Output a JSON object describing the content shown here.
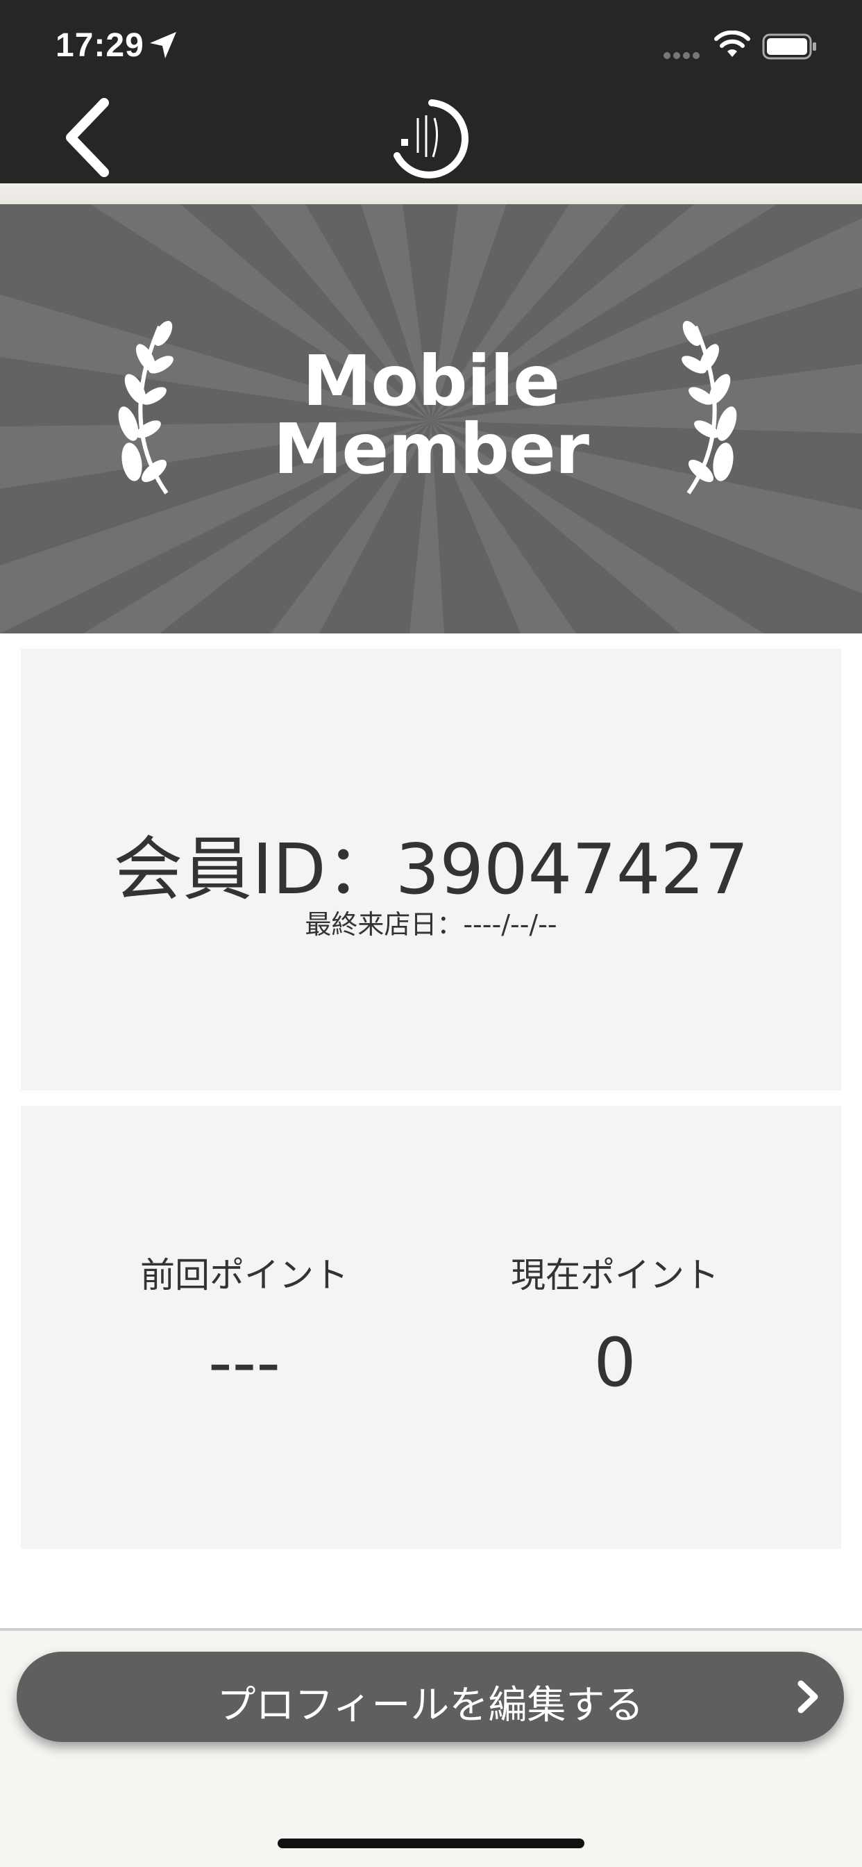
{
  "status_bar": {
    "time": "17:29"
  },
  "nav": {
    "back_icon": "chevron-left-icon",
    "logo_icon": "brand-logo-icon"
  },
  "banner": {
    "line1": "Mobile",
    "line2": "Member"
  },
  "member": {
    "id_text": "会員ID：39047427",
    "last_visit": "最終来店日：----/--/--"
  },
  "points": {
    "previous_label": "前回ポイント",
    "previous_value": "---",
    "current_label": "現在ポイント",
    "current_value": "0"
  },
  "actions": {
    "edit_profile_label": "プロフィールを編集する"
  },
  "colors": {
    "topbar": "#262626",
    "banner": "#636363",
    "card": "#f4f4f4",
    "button": "#5f5f5f"
  }
}
